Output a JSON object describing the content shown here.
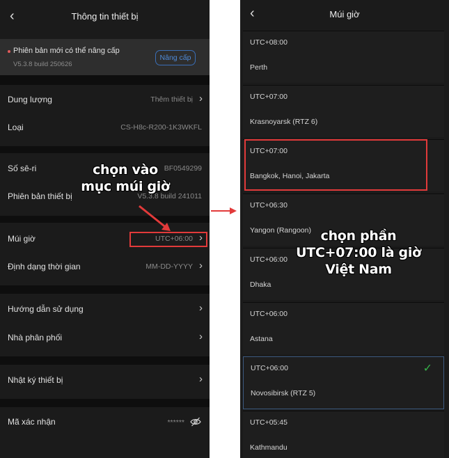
{
  "left": {
    "title": "Thông tin thiết bị",
    "back_icon": "chevron-left-icon",
    "update": {
      "message": "Phiên bản mới có thể nâng cấp",
      "version": "V5.3.8 build 250626",
      "button": "Nâng cấp"
    },
    "rows": [
      {
        "label": "Dung lượng",
        "value": "Thêm thiết bị"
      },
      {
        "label": "Loại",
        "value": "CS-H8c-R200-1K3WKFL"
      },
      {
        "label": "Số sê-ri",
        "value": "BF0549299"
      },
      {
        "label": "Phiên bản thiết bị",
        "value": "V5.3.8 build 241011"
      },
      {
        "label": "Múi giờ",
        "value": "UTC+06:00"
      },
      {
        "label": "Định dạng thời gian",
        "value": "MM-DD-YYYY"
      },
      {
        "label": "Hướng dẫn sử dụng",
        "value": ""
      },
      {
        "label": "Nhà phân phối",
        "value": ""
      },
      {
        "label": "Nhật ký thiết bị",
        "value": ""
      },
      {
        "label": "Mã xác nhận",
        "value": "******"
      }
    ]
  },
  "annotations": {
    "callout1": "chọn vào\nmục múi giờ",
    "callout2": "chọn phần\nUTC+07:00 là giờ\nViệt Nam",
    "accent_red": "#e23a3a",
    "check_green": "#36b24a"
  },
  "right": {
    "title": "Múi giờ",
    "zones": [
      {
        "offset": "UTC+08:00",
        "city": "Perth"
      },
      {
        "offset": "UTC+07:00",
        "city": "Krasnoyarsk (RTZ 6)"
      },
      {
        "offset": "UTC+07:00",
        "city": "Bangkok, Hanoi, Jakarta"
      },
      {
        "offset": "UTC+06:30",
        "city": "Yangon (Rangoon)"
      },
      {
        "offset": "UTC+06:00",
        "city": "Dhaka"
      },
      {
        "offset": "UTC+06:00",
        "city": "Astana"
      },
      {
        "offset": "UTC+06:00",
        "city": "Novosibirsk (RTZ 5)",
        "selected": true
      },
      {
        "offset": "UTC+05:45",
        "city": "Kathmandu"
      }
    ]
  }
}
